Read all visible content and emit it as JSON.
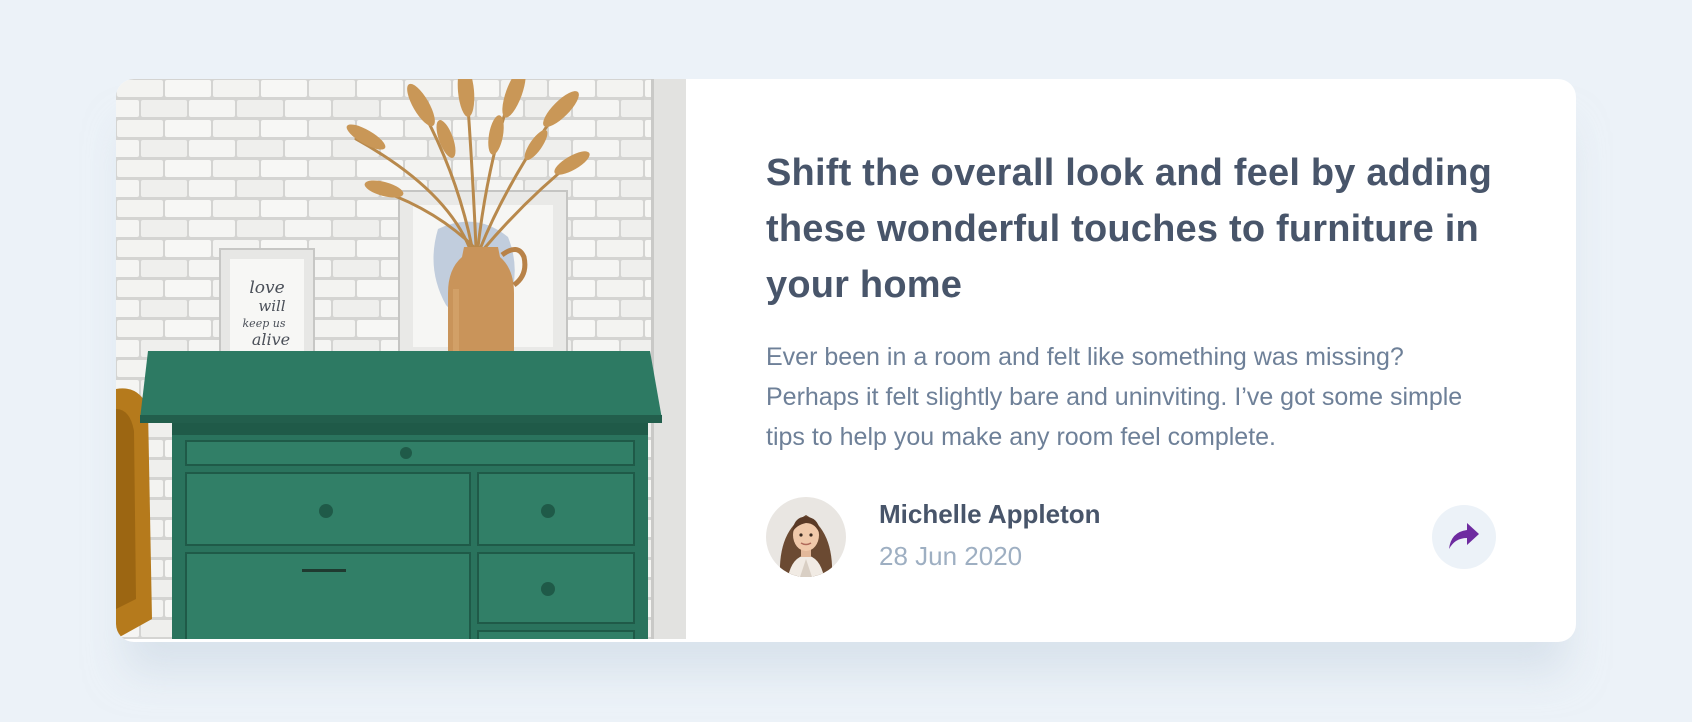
{
  "article": {
    "title": "Shift the overall look and feel by adding these wonderful touches to furniture in your home",
    "description": "Ever been in a room and felt like something was missing? Perhaps it felt slightly bare and uninviting. I’ve got some simple tips to help you make any room feel complete."
  },
  "author": {
    "name": "Michelle Appleton",
    "date": "28 Jun 2020"
  },
  "photo": {
    "frame_text_line1": "love",
    "frame_text_line2": "will",
    "frame_text_line3": "keep us",
    "frame_text_line4": "alive"
  },
  "share": {
    "icon": "share-icon",
    "icon_color": "#6e2ba0"
  },
  "colors": {
    "background": "#ecf2f8",
    "card": "#ffffff",
    "title": "#48556a",
    "text": "#6e8098",
    "muted": "#9eafc2"
  }
}
